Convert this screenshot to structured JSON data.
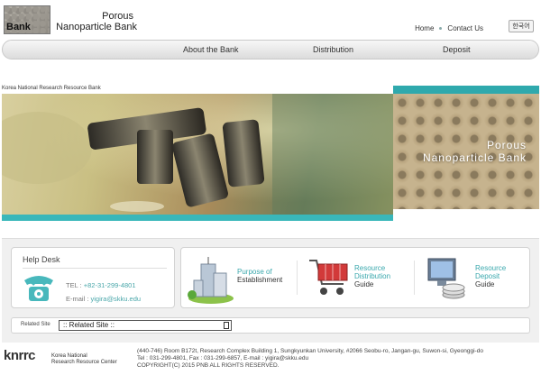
{
  "header": {
    "logo_word": "Bank",
    "brand_line1": "Porous",
    "brand_line2": "Nanoparticle Bank",
    "links": [
      "Home",
      "Contact Us"
    ],
    "lang_button": "한국어"
  },
  "nav": {
    "items": [
      "About the Bank",
      "Distribution",
      "Deposit"
    ]
  },
  "org_label": "Korea National Research Resource Bank",
  "banner": {
    "title_line1": "Porous",
    "title_line2": "Nanoparticle Bank",
    "accent_color": "#39b7ba"
  },
  "helpdesk": {
    "title": "Help Desk",
    "tel_label": "TEL :",
    "tel_value": "+82-31-299-4801",
    "email_label": "E-mail :",
    "email_value": "yigira@skku.edu"
  },
  "services": [
    {
      "line1": "Purpose of",
      "line2": "",
      "sub": "Establishment"
    },
    {
      "line1": "Resource",
      "line2": "Distribution",
      "sub": "Guide"
    },
    {
      "line1": "Resource",
      "line2": "Deposit",
      "sub": "Guide"
    }
  ],
  "related": {
    "label": "Related Site",
    "selected": ":: Related Site ::"
  },
  "footer": {
    "logo_text": "knrrc",
    "org_line1": "Korea National",
    "org_line2": "Research Resource Center",
    "address": "(440-746) Room B172t, Research Complex Building 1, Sungkyunkan University, #2066 Seobu-ro, Jangan-gu, Suwon-si, Gyeonggi-do",
    "contact": "Tel : 031-299-4801, Fax : 031-299-6857, E-mail : yigira@skku.edu",
    "copyright": "COPYRIGHT(C) 2015 PNB ALL RIGHTS RESERVED."
  }
}
